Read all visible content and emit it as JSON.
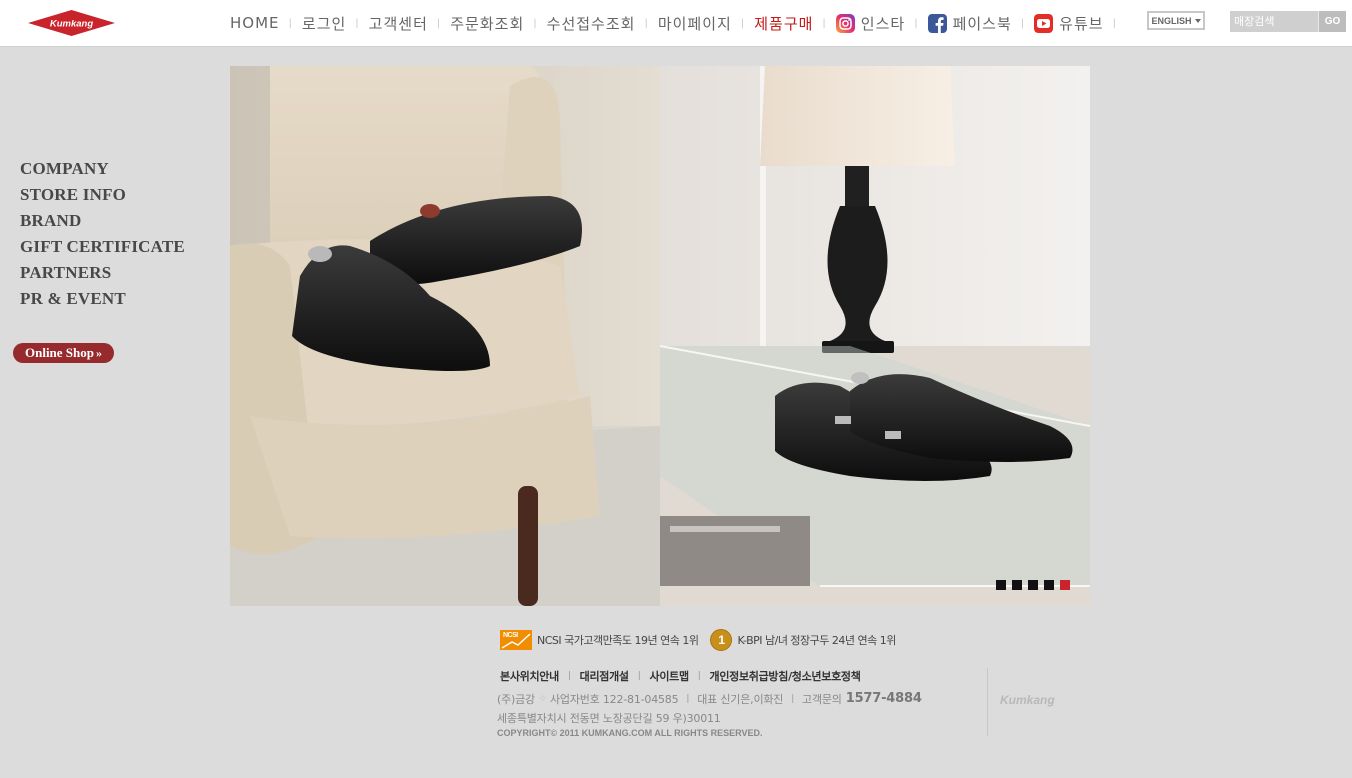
{
  "header": {
    "logo_text": "Kumkang",
    "nav": [
      {
        "label": "HOME"
      },
      {
        "label": "로그인"
      },
      {
        "label": "고객센터"
      },
      {
        "label": "주문화조회"
      },
      {
        "label": "수선접수조회"
      },
      {
        "label": "마이페이지"
      },
      {
        "label": "제품구매",
        "active": true
      }
    ],
    "social": [
      {
        "label": "인스타",
        "icon": "instagram-icon"
      },
      {
        "label": "페이스북",
        "icon": "facebook-icon"
      },
      {
        "label": "유튜브",
        "icon": "youtube-icon"
      }
    ],
    "language": "ENGLISH",
    "search": {
      "placeholder": "매장검색",
      "button": "GO"
    }
  },
  "sidebar": {
    "items": [
      "COMPANY",
      "STORE INFO",
      "BRAND",
      "GIFT CERTIFICATE",
      "PARTNERS",
      "PR & EVENT"
    ],
    "online_shop": "Online Shop"
  },
  "hero": {
    "slide_count": 5,
    "active_slide": 5,
    "images": [
      "black-cap-toe-oxford-on-chair",
      "black-double-monk-strap-on-glass-table"
    ]
  },
  "footer": {
    "awards": [
      {
        "badge": "NCSI",
        "text": "NCSI 국가고객만족도 19년 연속 1위"
      },
      {
        "badge": "1",
        "text": "K-BPI 남/녀 정장구두 24년 연속 1위"
      }
    ],
    "links": [
      "본사위치안내",
      "대리점개설",
      "사이트맵",
      "개인정보취급방침/청소년보호정책"
    ],
    "company": "(주)금강",
    "biz_no": "사업자번호 122-81-04585",
    "ceo": "대표 신기은,이화진",
    "phone_label": "고객문의",
    "phone": "1577-4884",
    "address": "세종특별자치시 전동면 노장공단길 59 우)30011",
    "copyright": "COPYRIGHT© 2011 KUMKANG.COM ALL RIGHTS RESERVED.",
    "logo_text": "Kumkang"
  },
  "colors": {
    "accent": "#c41a1a",
    "online_shop": "#962a2d",
    "background": "#dcdcdc"
  }
}
